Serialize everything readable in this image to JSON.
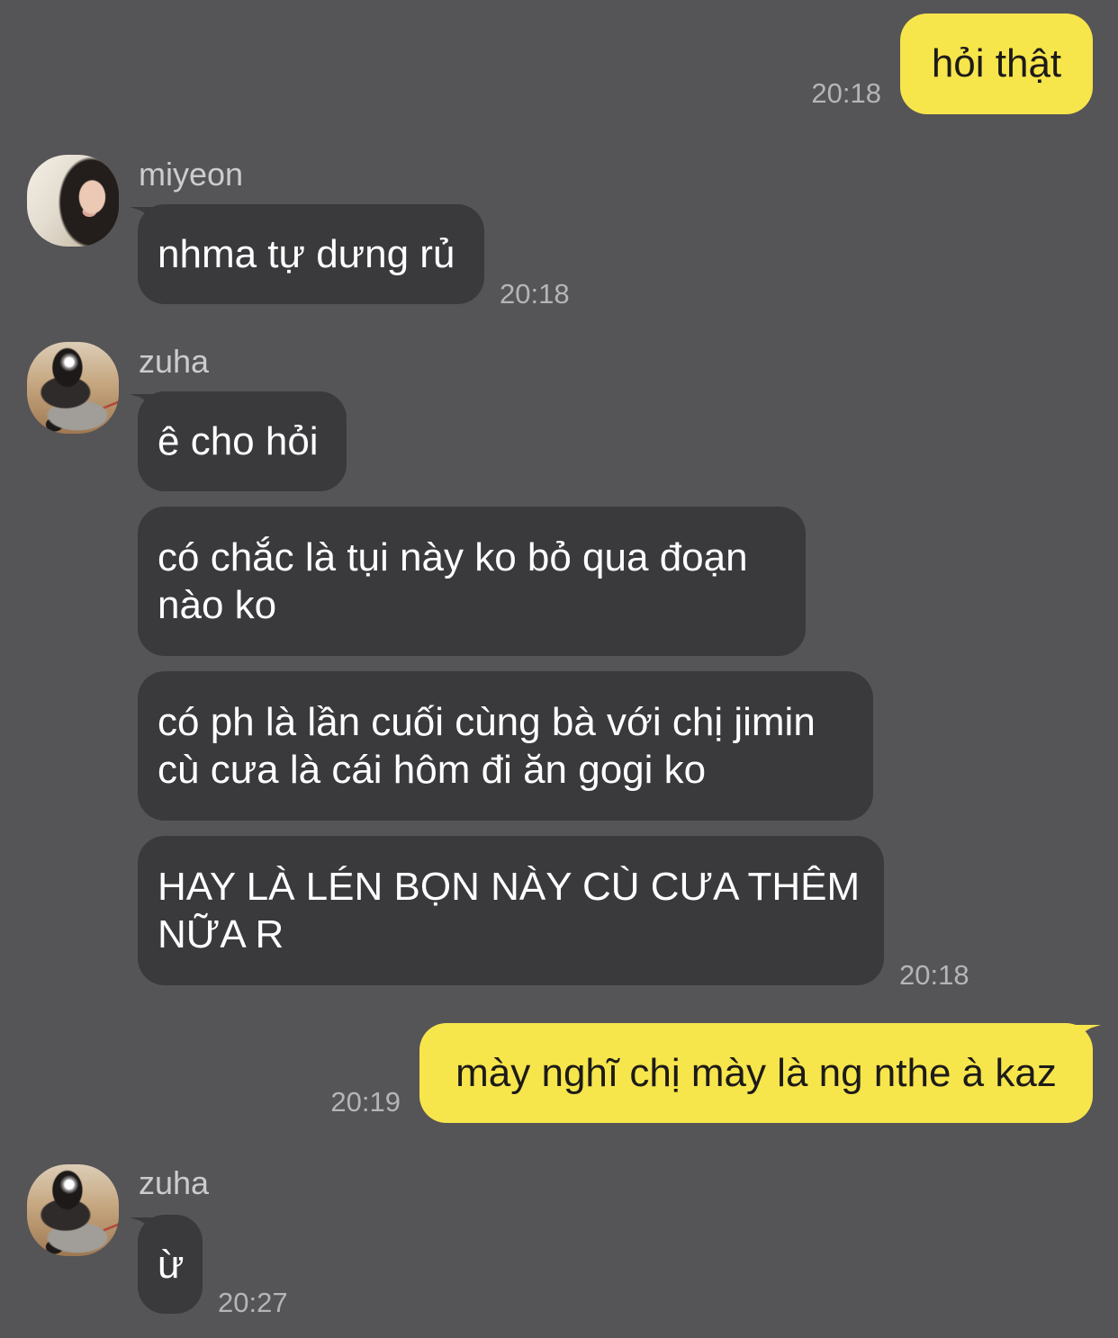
{
  "theme": {
    "background": "#555456",
    "incoming_bubble": "#3a393c",
    "outgoing_bubble": "#f7e54c",
    "incoming_text": "#ffffff",
    "outgoing_text": "#1c1b19",
    "timestamp": "#b5b4b6",
    "sender_name": "#cccbcd"
  },
  "conversation": [
    {
      "from_me": true,
      "bubbles": [
        "hỏi thật"
      ],
      "time": "20:18"
    },
    {
      "from_me": false,
      "sender": "miyeon",
      "bubbles": [
        "nhma tự dưng rủ"
      ],
      "time": "20:18"
    },
    {
      "from_me": false,
      "sender": "zuha",
      "bubbles": [
        "ê cho hỏi",
        "có chắc là tụi này ko bỏ qua đoạn\nnào ko",
        "có ph là lần cuối cùng bà với chị jimin\ncù cưa là cái hôm đi ăn gogi ko",
        "HAY LÀ LÉN BỌN NÀY CÙ CƯA THÊM\nNỮA R"
      ],
      "time": "20:18"
    },
    {
      "from_me": true,
      "bubbles": [
        "mày nghĩ chị mày là ng nthe à kaz"
      ],
      "time": "20:19"
    },
    {
      "from_me": false,
      "sender": "zuha",
      "bubbles": [
        "ừ"
      ],
      "time": "20:27"
    }
  ]
}
